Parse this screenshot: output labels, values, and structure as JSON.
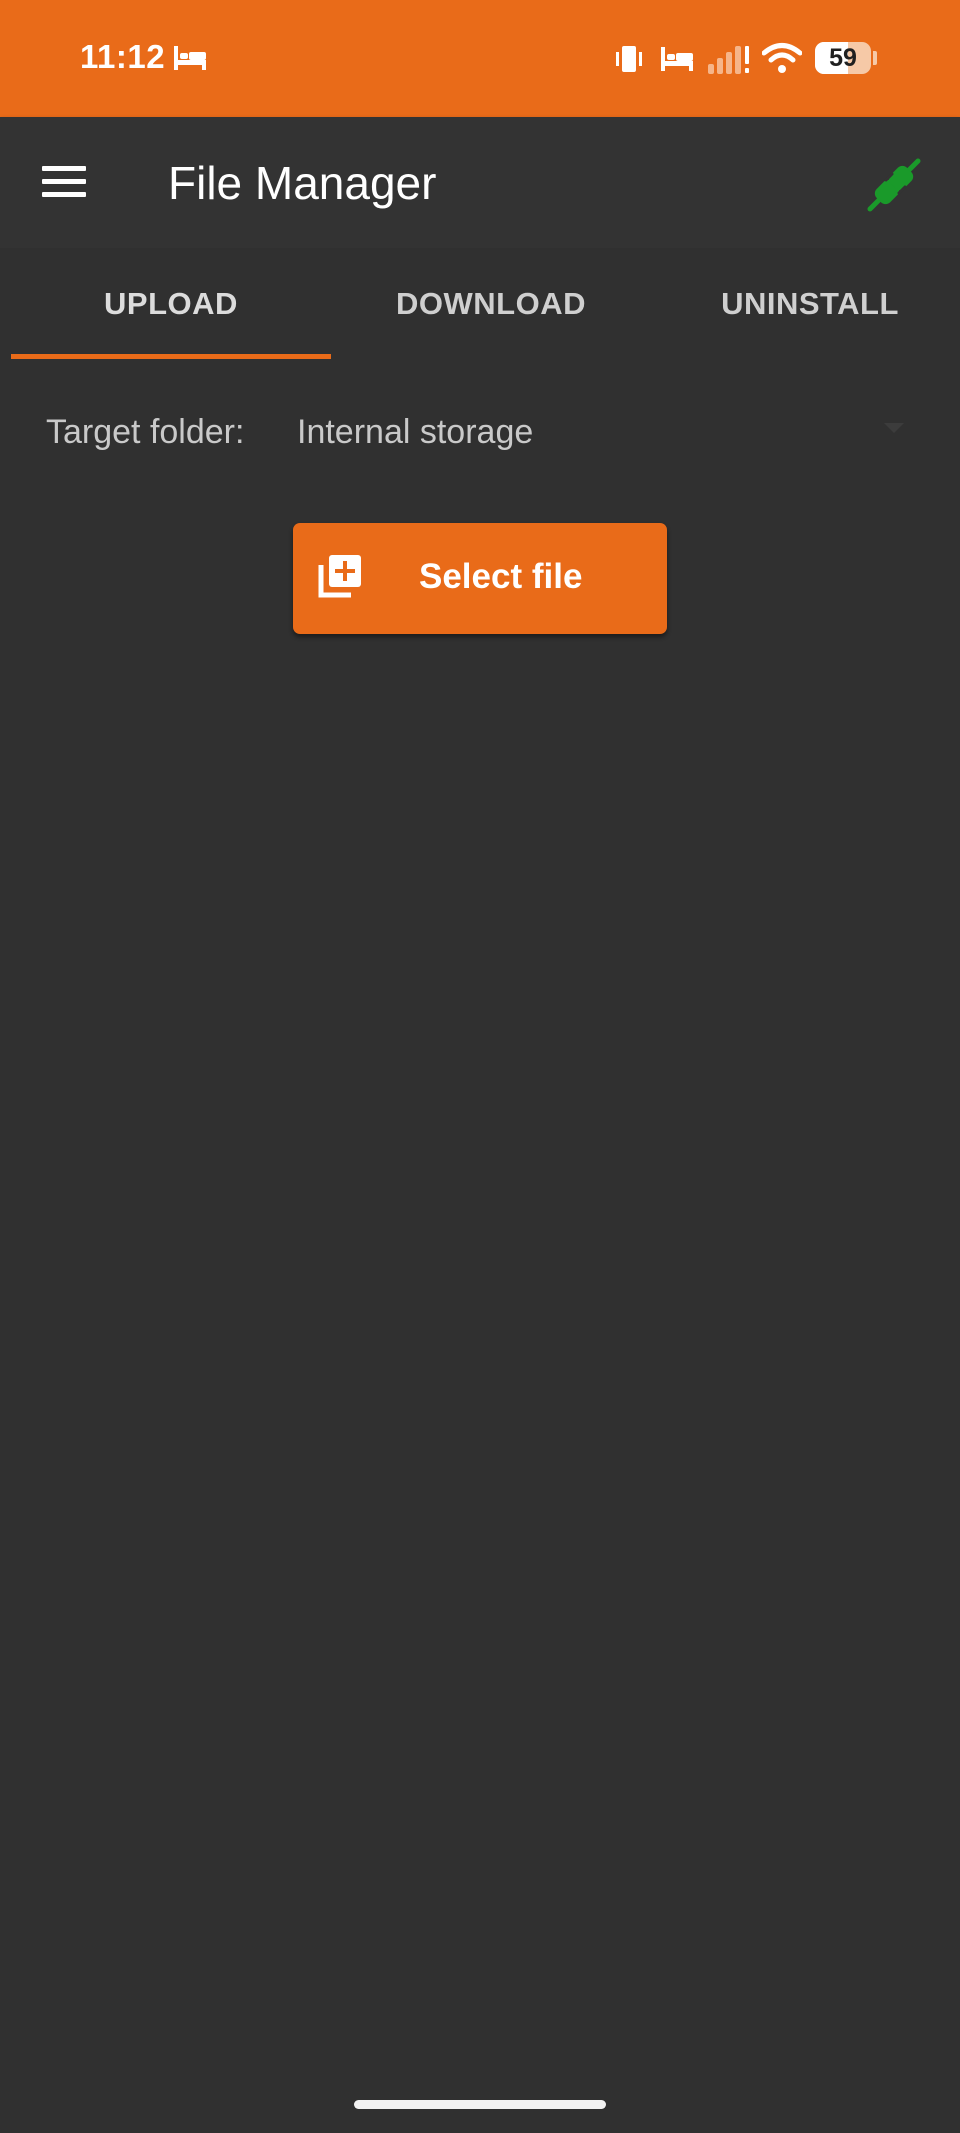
{
  "status_bar": {
    "time": "11:12",
    "battery_level": "59",
    "icons": [
      "bed-icon",
      "vibrate-icon",
      "bed-icon",
      "signal-icon",
      "wifi-icon",
      "battery-icon"
    ]
  },
  "app_bar": {
    "title": "File Manager",
    "menu_icon": "hamburger-menu-icon",
    "connection_icon": "plug-connected-icon"
  },
  "tabs": [
    {
      "label": "UPLOAD",
      "active": true
    },
    {
      "label": "DOWNLOAD",
      "active": false
    },
    {
      "label": "UNINSTALL",
      "active": false
    }
  ],
  "target_folder": {
    "label": "Target folder:",
    "value": "Internal storage"
  },
  "select_file_button": {
    "label": "Select file",
    "icon": "add-to-library-icon"
  },
  "colors": {
    "accent": "#e96b19",
    "background": "#303030",
    "app_bar": "#333333",
    "connected": "#1a9a2a"
  }
}
